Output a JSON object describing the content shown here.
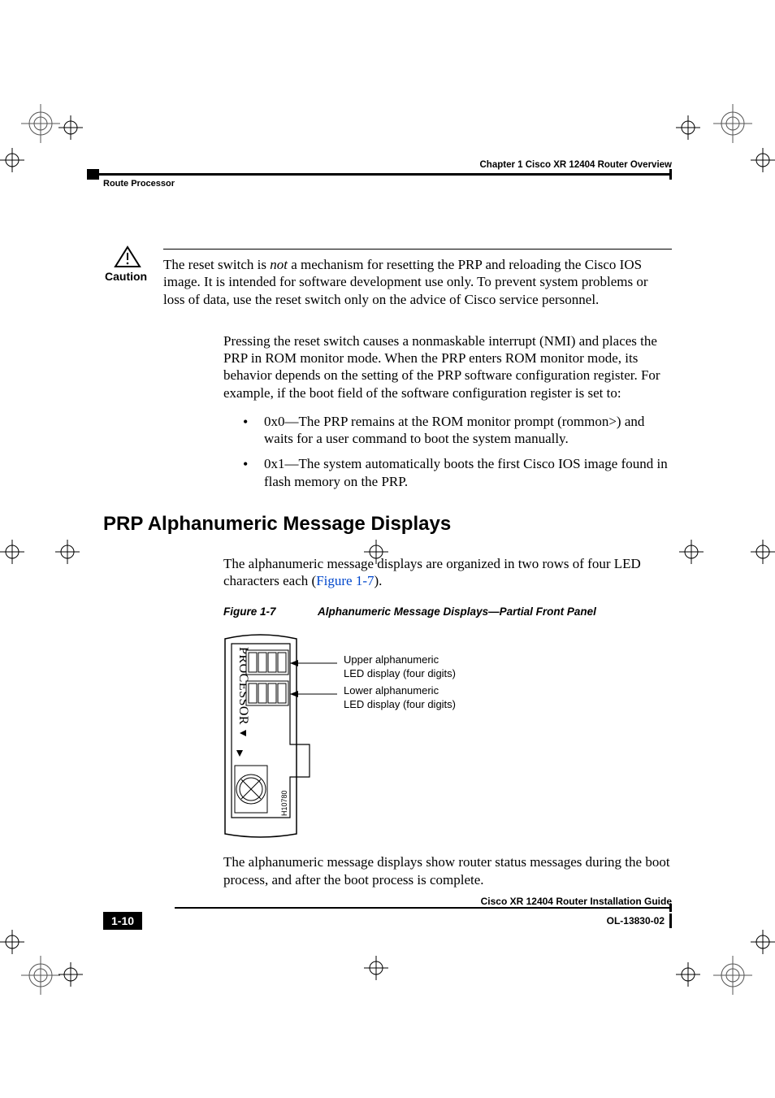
{
  "header": {
    "chapter": "Chapter 1      Cisco XR 12404 Router Overview",
    "section": "Route Processor"
  },
  "caution": {
    "label": "Caution",
    "text_prefix": "The reset switch is ",
    "text_em": "not",
    "text_suffix": " a mechanism for resetting the PRP and reloading the Cisco IOS image. It is intended for software development use only. To prevent system problems or loss of data, use the reset switch only on the advice of Cisco service personnel."
  },
  "para_nmi": "Pressing the reset switch causes a nonmaskable interrupt (NMI) and places the PRP in ROM monitor mode. When the PRP enters ROM monitor mode, its behavior depends on the setting of the PRP software configuration register. For example, if the boot field of the software configuration register is set to:",
  "bullets": [
    "0x0—The PRP remains at the ROM monitor prompt (rommon>) and waits for a user command to boot the system manually.",
    "0x1—The system automatically boots the first Cisco IOS image found in flash memory on the PRP."
  ],
  "section_heading": "PRP Alphanumeric Message Displays",
  "para_intro_prefix": "The alphanumeric message displays are organized in two rows of four LED characters each (",
  "para_intro_xref": "Figure 1-7",
  "para_intro_suffix": ").",
  "figure": {
    "label": "Figure 1-7",
    "title": "Alphanumeric Message Displays—Partial Front Panel",
    "side_label": "PROCESSOR",
    "callout_upper_l1": "Upper alphanumeric",
    "callout_upper_l2": "LED display (four digits)",
    "callout_lower_l1": "Lower alphanumeric",
    "callout_lower_l2": "LED display (four digits)",
    "drawing_id": "H10780"
  },
  "para_after_fig": "The alphanumeric message displays show router status messages during the boot process, and after the boot process is complete.",
  "footer": {
    "guide_title": "Cisco XR 12404 Router Installation Guide",
    "page_number": "1-10",
    "doc_number": "OL-13830-02"
  }
}
